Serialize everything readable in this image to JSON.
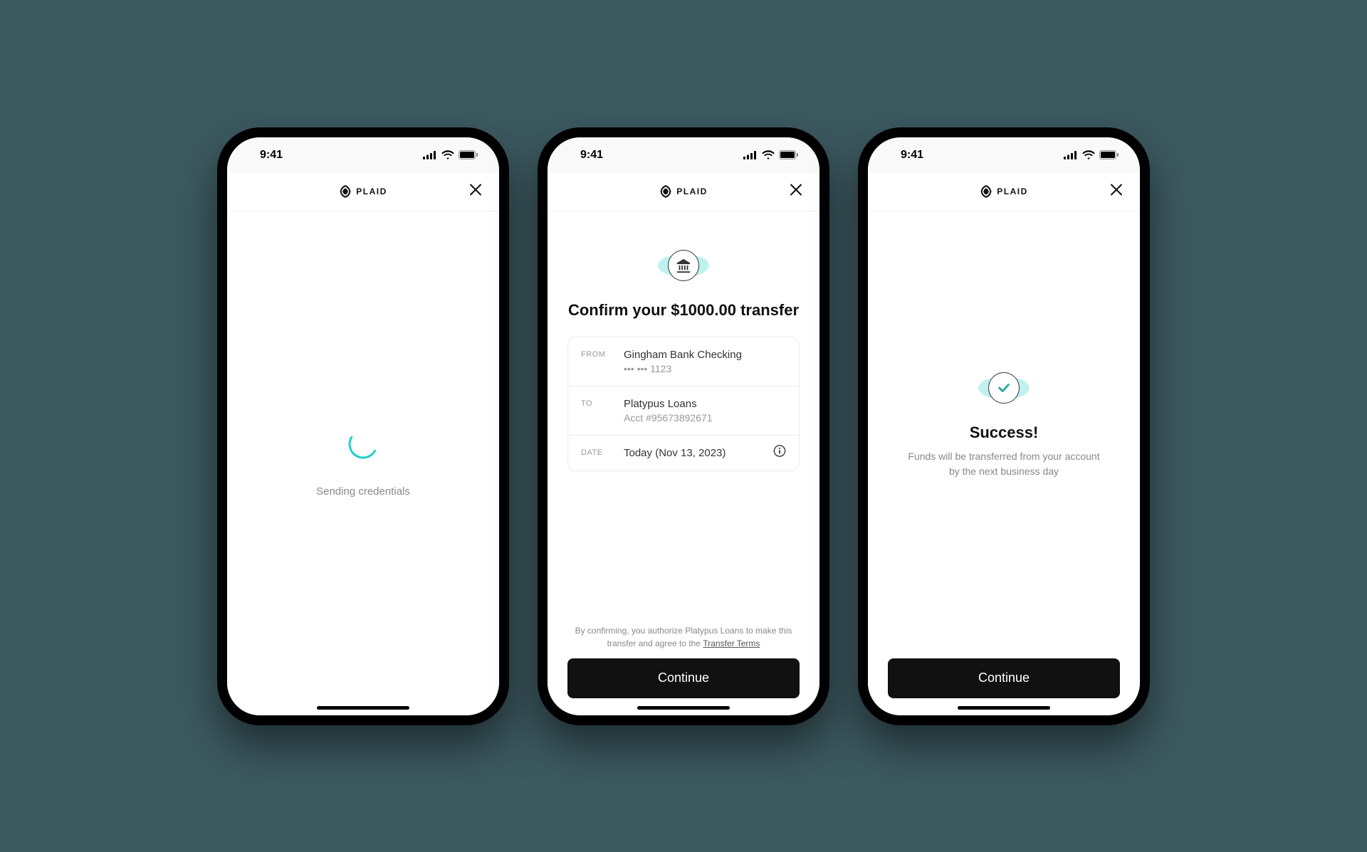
{
  "statusbar": {
    "time": "9:41"
  },
  "header": {
    "brand": "PLAID"
  },
  "screen1": {
    "loading_text": "Sending credentials"
  },
  "screen2": {
    "title": "Confirm your $1000.00 transfer",
    "from_label": "FROM",
    "from_name": "Gingham Bank Checking",
    "from_acct": "••• ••• 1123",
    "to_label": "TO",
    "to_name": "Platypus Loans",
    "to_acct": "Acct #95673892671",
    "date_label": "DATE",
    "date_value": "Today (Nov 13, 2023)",
    "disclaimer_pre": "By confirming, you authorize Platypus Loans to make this transfer and agree to the ",
    "disclaimer_link": "Transfer Terms",
    "continue": "Continue"
  },
  "screen3": {
    "title": "Success!",
    "subtitle": "Funds will be transferred from your account by the next business day",
    "continue": "Continue"
  }
}
